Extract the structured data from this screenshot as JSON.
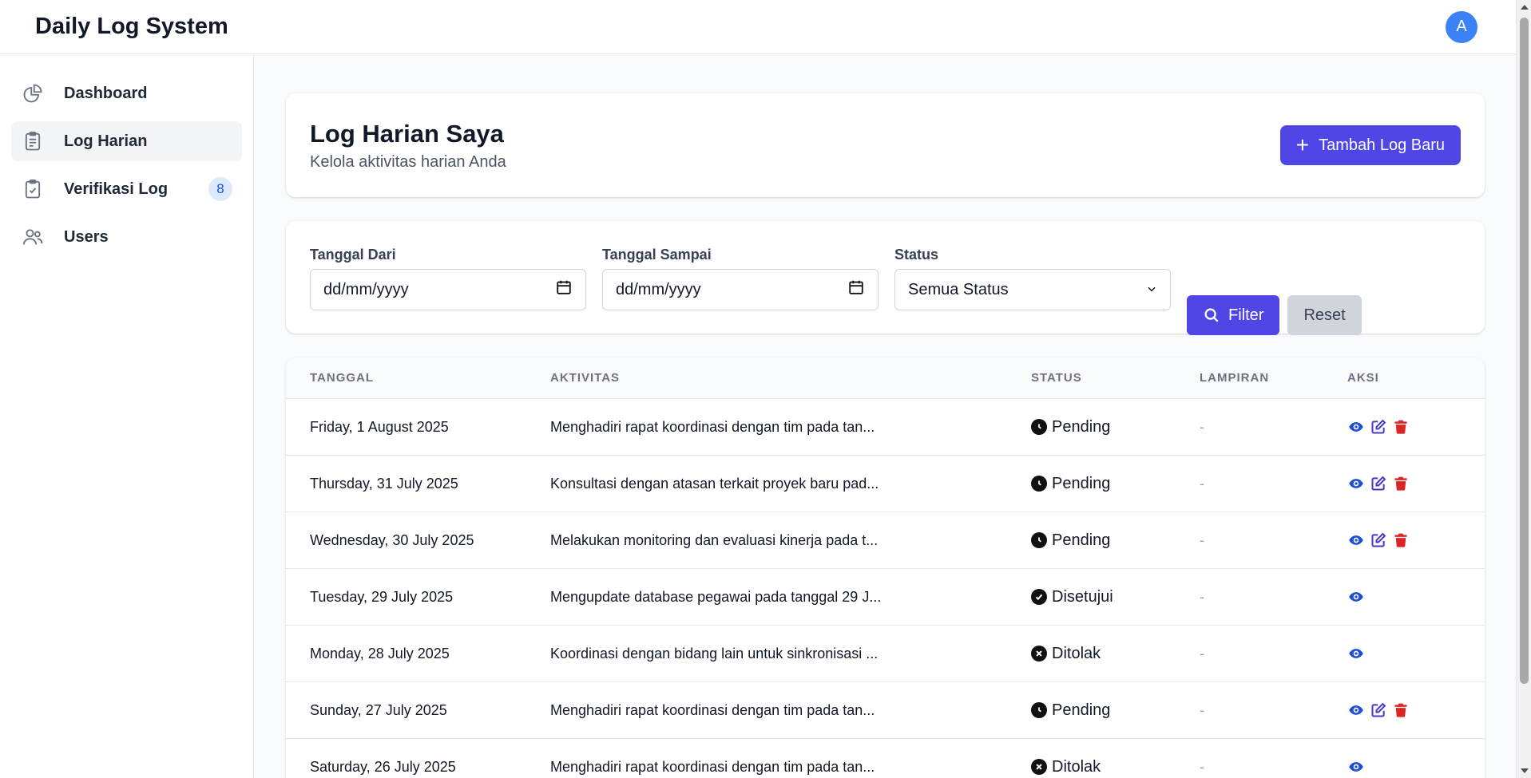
{
  "app": {
    "title": "Daily Log System",
    "avatar_initial": "A"
  },
  "sidebar": {
    "items": [
      {
        "label": "Dashboard",
        "icon": "pie-chart-icon",
        "active": false
      },
      {
        "label": "Log Harian",
        "icon": "clipboard-list-icon",
        "active": true
      },
      {
        "label": "Verifikasi Log",
        "icon": "clipboard-check-icon",
        "active": false,
        "badge": "8"
      },
      {
        "label": "Users",
        "icon": "users-icon",
        "active": false
      }
    ]
  },
  "header": {
    "title": "Log Harian Saya",
    "subtitle": "Kelola aktivitas harian Anda",
    "add_button": "Tambah Log Baru"
  },
  "filters": {
    "date_from": {
      "label": "Tanggal Dari",
      "value": "dd/mm/yyyy"
    },
    "date_to": {
      "label": "Tanggal Sampai",
      "value": "dd/mm/yyyy"
    },
    "status": {
      "label": "Status",
      "value": "Semua Status"
    },
    "filter_button": "Filter",
    "reset_button": "Reset"
  },
  "table": {
    "columns": [
      "TANGGAL",
      "AKTIVITAS",
      "STATUS",
      "LAMPIRAN",
      "AKSI"
    ],
    "rows": [
      {
        "date": "Friday, 1 August 2025",
        "activity": "Menghadiri rapat koordinasi dengan tim pada tan...",
        "status": "Pending",
        "attachment": "-",
        "actions": [
          "view",
          "edit",
          "delete"
        ]
      },
      {
        "date": "Thursday, 31 July 2025",
        "activity": "Konsultasi dengan atasan terkait proyek baru pad...",
        "status": "Pending",
        "attachment": "-",
        "actions": [
          "view",
          "edit",
          "delete"
        ]
      },
      {
        "date": "Wednesday, 30 July 2025",
        "activity": "Melakukan monitoring dan evaluasi kinerja pada t...",
        "status": "Pending",
        "attachment": "-",
        "actions": [
          "view",
          "edit",
          "delete"
        ]
      },
      {
        "date": "Tuesday, 29 July 2025",
        "activity": "Mengupdate database pegawai pada tanggal 29 J...",
        "status": "Disetujui",
        "attachment": "-",
        "actions": [
          "view"
        ]
      },
      {
        "date": "Monday, 28 July 2025",
        "activity": "Koordinasi dengan bidang lain untuk sinkronisasi ...",
        "status": "Ditolak",
        "attachment": "-",
        "actions": [
          "view"
        ]
      },
      {
        "date": "Sunday, 27 July 2025",
        "activity": "Menghadiri rapat koordinasi dengan tim pada tan...",
        "status": "Pending",
        "attachment": "-",
        "actions": [
          "view",
          "edit",
          "delete"
        ]
      },
      {
        "date": "Saturday, 26 July 2025",
        "activity": "Menghadiri rapat koordinasi dengan tim pada tan...",
        "status": "Ditolak",
        "attachment": "-",
        "actions": [
          "view"
        ]
      }
    ]
  },
  "colors": {
    "primary": "#4f46e5",
    "avatar": "#3b82f6",
    "view_icon": "#1d4ed8",
    "edit_icon": "#4338ca",
    "delete_icon": "#dc2626",
    "badge_bg": "#dbeafe"
  }
}
